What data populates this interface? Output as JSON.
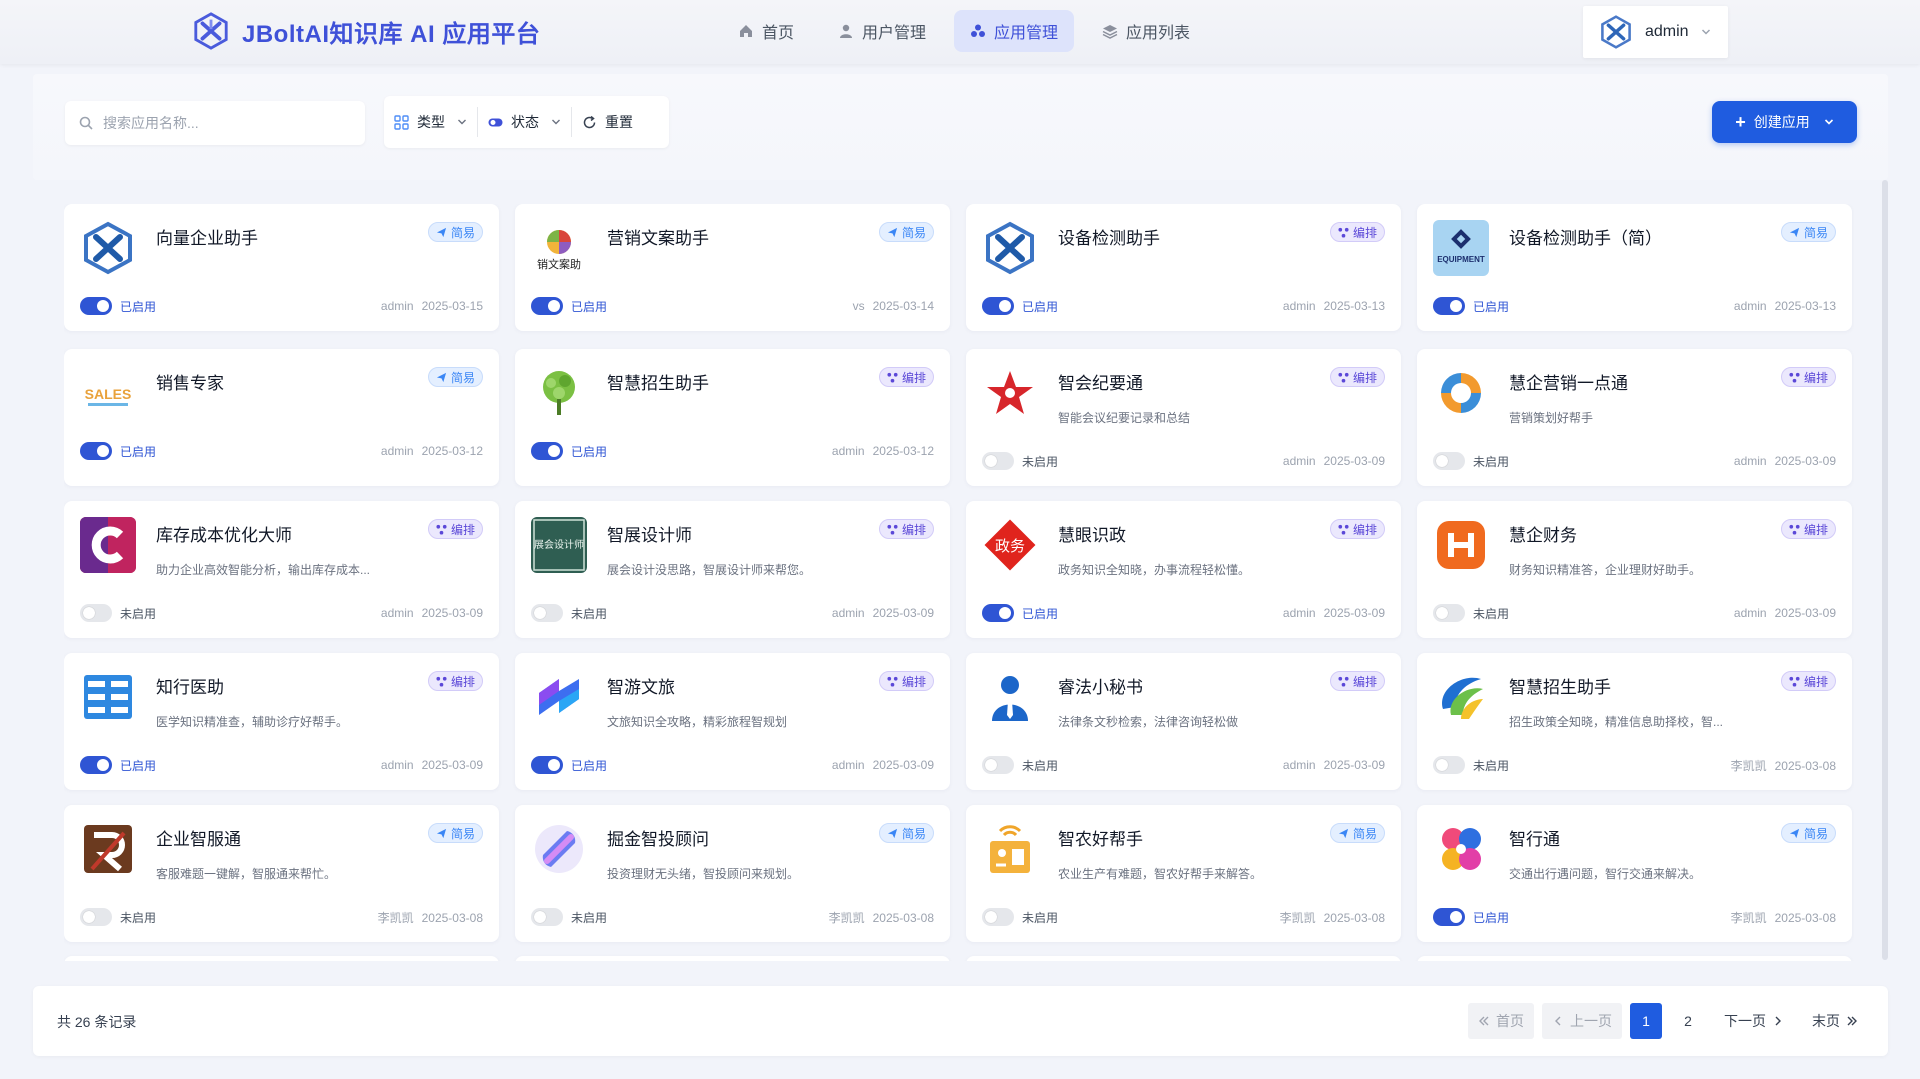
{
  "header": {
    "title": "JBoltAI知识库 AI 应用平台",
    "nav": [
      {
        "label": "首页",
        "icon": "home-icon"
      },
      {
        "label": "用户管理",
        "icon": "user-icon"
      },
      {
        "label": "应用管理",
        "icon": "cubes-icon",
        "active": true
      },
      {
        "label": "应用列表",
        "icon": "layers-icon"
      }
    ],
    "user": "admin"
  },
  "toolbar": {
    "search_placeholder": "搜索应用名称...",
    "filter_type": "类型",
    "filter_status": "状态",
    "reset": "重置",
    "create": "创建应用"
  },
  "cards": [
    {
      "name": "向量企业助手",
      "desc": "",
      "tag": "简易",
      "on": true,
      "status": "已启用",
      "author": "admin",
      "date": "2025-03-15"
    },
    {
      "name": "营销文案助手",
      "desc": "",
      "tag": "简易",
      "on": true,
      "status": "已启用",
      "author": "vs",
      "date": "2025-03-14"
    },
    {
      "name": "设备检测助手",
      "desc": "",
      "tag": "编排",
      "on": true,
      "status": "已启用",
      "author": "admin",
      "date": "2025-03-13"
    },
    {
      "name": "设备检测助手（简）",
      "desc": "",
      "tag": "简易",
      "on": true,
      "status": "已启用",
      "author": "admin",
      "date": "2025-03-13"
    },
    {
      "name": "销售专家",
      "desc": "",
      "tag": "简易",
      "on": true,
      "status": "已启用",
      "author": "admin",
      "date": "2025-03-12"
    },
    {
      "name": "智慧招生助手",
      "desc": "",
      "tag": "编排",
      "on": true,
      "status": "已启用",
      "author": "admin",
      "date": "2025-03-12"
    },
    {
      "name": "智会纪要通",
      "desc": "智能会议纪要记录和总结",
      "tag": "编排",
      "on": false,
      "status": "未启用",
      "author": "admin",
      "date": "2025-03-09"
    },
    {
      "name": "慧企营销一点通",
      "desc": "营销策划好帮手",
      "tag": "编排",
      "on": false,
      "status": "未启用",
      "author": "admin",
      "date": "2025-03-09"
    },
    {
      "name": "库存成本优化大师",
      "desc": "助力企业高效智能分析，输出库存成本...",
      "tag": "编排",
      "on": false,
      "status": "未启用",
      "author": "admin",
      "date": "2025-03-09"
    },
    {
      "name": "智展设计师",
      "desc": "展会设计没思路，智展设计师来帮您。",
      "tag": "编排",
      "on": false,
      "status": "未启用",
      "author": "admin",
      "date": "2025-03-09"
    },
    {
      "name": "慧眼识政",
      "desc": "政务知识全知晓，办事流程轻松懂。",
      "tag": "编排",
      "on": true,
      "status": "已启用",
      "author": "admin",
      "date": "2025-03-09"
    },
    {
      "name": "慧企财务",
      "desc": "财务知识精准答，企业理财好助手。",
      "tag": "编排",
      "on": false,
      "status": "未启用",
      "author": "admin",
      "date": "2025-03-09"
    },
    {
      "name": "知行医助",
      "desc": "医学知识精准查，辅助诊疗好帮手。",
      "tag": "编排",
      "on": true,
      "status": "已启用",
      "author": "admin",
      "date": "2025-03-09"
    },
    {
      "name": "智游文旅",
      "desc": "文旅知识全攻略，精彩旅程智规划",
      "tag": "编排",
      "on": true,
      "status": "已启用",
      "author": "admin",
      "date": "2025-03-09"
    },
    {
      "name": "睿法小秘书",
      "desc": "法律条文秒检索，法律咨询轻松做",
      "tag": "编排",
      "on": false,
      "status": "未启用",
      "author": "admin",
      "date": "2025-03-09"
    },
    {
      "name": "智慧招生助手",
      "desc": "招生政策全知晓，精准信息助择校，智...",
      "tag": "编排",
      "on": false,
      "status": "未启用",
      "author": "李凯凯",
      "date": "2025-03-08"
    },
    {
      "name": "企业智服通",
      "desc": "客服难题一键解，智服通来帮忙。",
      "tag": "简易",
      "on": false,
      "status": "未启用",
      "author": "李凯凯",
      "date": "2025-03-08"
    },
    {
      "name": "掘金智投顾问",
      "desc": "投资理财无头绪，智投顾问来规划。",
      "tag": "简易",
      "on": false,
      "status": "未启用",
      "author": "李凯凯",
      "date": "2025-03-08"
    },
    {
      "name": "智农好帮手",
      "desc": "农业生产有难题，智农好帮手来解答。",
      "tag": "简易",
      "on": false,
      "status": "未启用",
      "author": "李凯凯",
      "date": "2025-03-08"
    },
    {
      "name": "智行通",
      "desc": "交通出行遇问题，智行交通来解决。",
      "tag": "简易",
      "on": true,
      "status": "已启用",
      "author": "李凯凯",
      "date": "2025-03-08"
    }
  ],
  "logo_text": {
    "yingxiao": "销文案助",
    "zhanhui": "展会设计师",
    "zhengwu": "政务",
    "sales": "SALES",
    "equipment": "EQUIPMENT"
  },
  "pagination": {
    "total": "共 26 条记录",
    "first": "首页",
    "prev": "上一页",
    "pages": [
      "1",
      "2"
    ],
    "current": "1",
    "next": "下一页",
    "last": "末页"
  },
  "colors": {
    "brand": "#3f51d8",
    "primary_button": "#1f5ce0",
    "toggle_on": "#2f55d4",
    "tag_simple": "#3a86f5",
    "tag_arrange": "#5b48d8"
  }
}
